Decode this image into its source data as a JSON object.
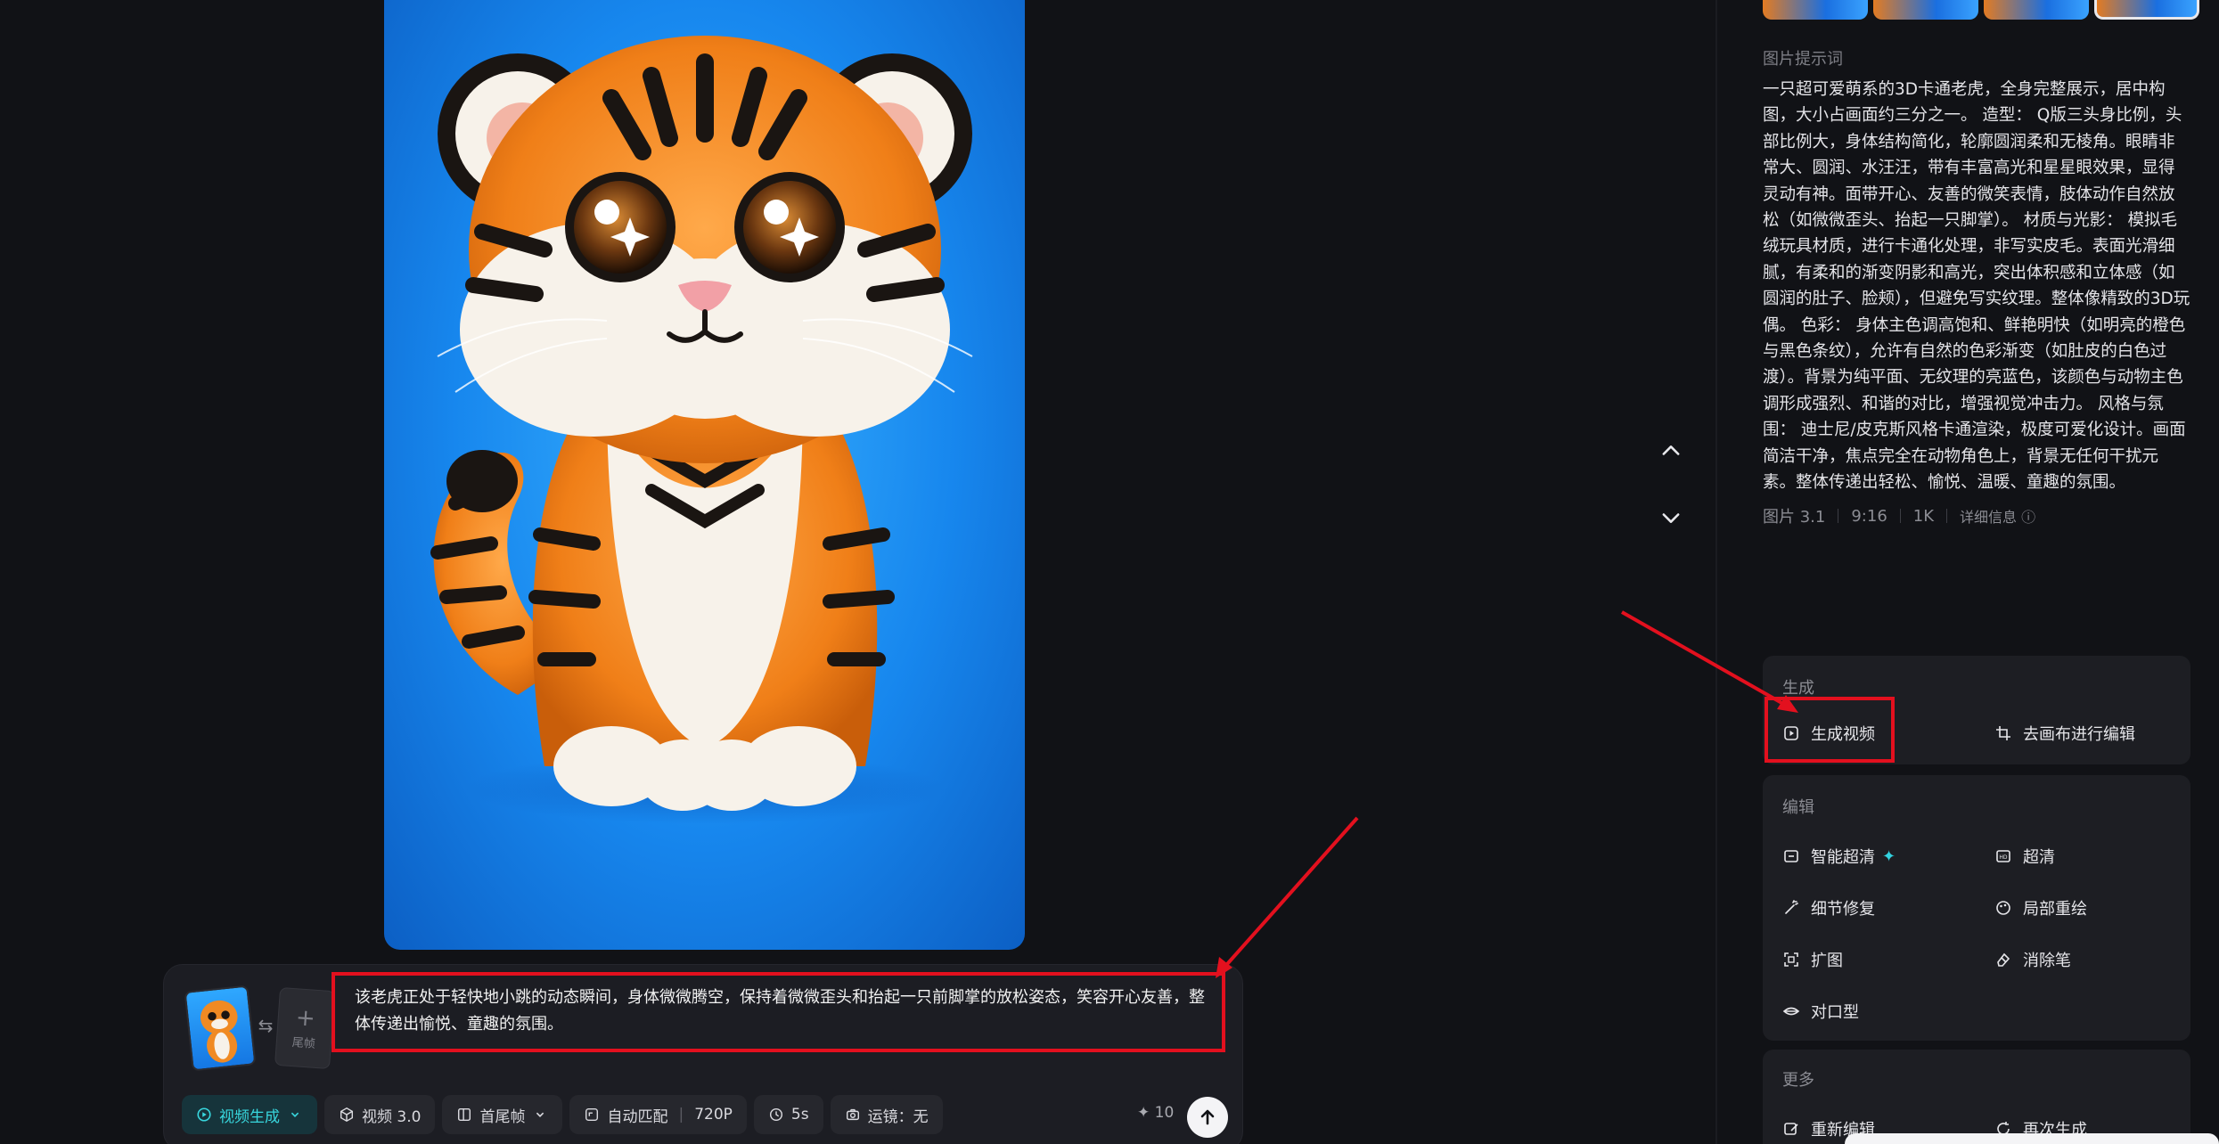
{
  "prompt_bar": {
    "tail_frame_label": "尾帧",
    "prompt_text": "该老虎正处于轻快地小跳的动态瞬间，身体微微腾空，保持着微微歪头和抬起一只前脚掌的放松姿态，笑容开心友善，整体传递出愉悦、童趣的氛围。",
    "toolbar": {
      "mode": "视频生成",
      "model": "视频 3.0",
      "frame_mode": "首尾帧",
      "ratio": "自动匹配",
      "resolution": "720P",
      "duration": "5s",
      "camera": "运镜：无"
    },
    "credits": "10"
  },
  "right_panel": {
    "prompt_label": "图片提示词",
    "prompt_description": "一只超可爱萌系的3D卡通老虎，全身完整展示，居中构图，大小占画面约三分之一。 造型： Q版三头身比例，头部比例大，身体结构简化，轮廓圆润柔和无棱角。眼睛非常大、圆润、水汪汪，带有丰富高光和星星眼效果，显得灵动有神。面带开心、友善的微笑表情，肢体动作自然放松（如微微歪头、抬起一只脚掌）。 材质与光影： 模拟毛绒玩具材质，进行卡通化处理，非写实皮毛。表面光滑细腻，有柔和的渐变阴影和高光，突出体积感和立体感（如圆润的肚子、脸颊），但避免写实纹理。整体像精致的3D玩偶。 色彩： 身体主色调高饱和、鲜艳明快（如明亮的橙色与黑色条纹），允许有自然的色彩渐变（如肚皮的白色过渡）。背景为纯平面、无纹理的亮蓝色，该颜色与动物主色调形成强烈、和谐的对比，增强视觉冲击力。 风格与氛围： 迪士尼/皮克斯风格卡通渲染，极度可爱化设计。画面简洁干净，焦点完全在动物角色上，背景无任何干扰元素。整体传递出轻松、愉悦、温暖、童趣的氛围。",
    "meta": {
      "model": "图片 3.1",
      "ratio": "9:16",
      "resolution": "1K",
      "details": "详细信息 ⓘ"
    },
    "generate_section": {
      "title": "生成",
      "generate_video": "生成视频",
      "canvas_edit": "去画布进行编辑"
    },
    "edit_section": {
      "title": "编辑",
      "smart_hd": "智能超清",
      "hd": "超清",
      "detail_repair": "细节修复",
      "inpaint": "局部重绘",
      "expand": "扩图",
      "eraser": "消除笔",
      "lip_sync": "对口型"
    },
    "more_section": {
      "title": "更多",
      "re_edit": "重新编辑",
      "regenerate": "再次生成"
    }
  },
  "colors": {
    "background": "#111216",
    "panel": "#1d1e23",
    "accent_cyan": "#38d6dd",
    "annotation_red": "#e3101e",
    "image_blue": "#1787ee"
  }
}
